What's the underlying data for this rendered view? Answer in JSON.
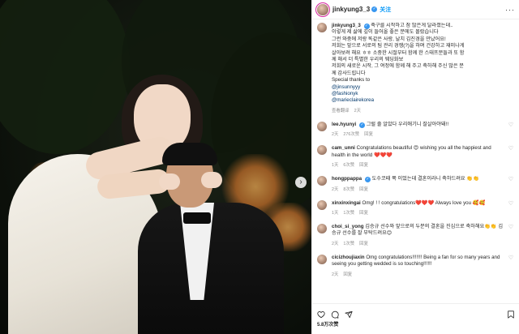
{
  "post": {
    "username": "jinkyung3_3",
    "follow_label": "关注",
    "more_label": "···",
    "caption": {
      "username": "jinkyung3_3",
      "lines": [
        "축구를 시작하고 참 많은게 달라졌는데..",
        "이렇게 제 삶에 깊이 들어올 좋은 분에도 몰랐습니다",
        "그런 와중에 저랑 똑같은 사랑, 날치 김진경을 만났어요!",
        "저희는 앞으로 서로의 팀 관리 경쟁(?)을 하며 건강하고 재미나게",
        "살아보려 해요 ㅎㅎ 소중한 시절부터 함께 한 스태프분들과 또 함",
        "께 해서 더 특별한 우리의 웨딩화보",
        "저희의 새로운 시작, 그 여정에 함께 해 주고 축하해 주신 많은 분",
        "께 감사드립니다"
      ],
      "special_thanks": "Special thanks to",
      "mentions": [
        "@jinsunnyyy",
        "@fashionyk",
        "@marieclairekorea"
      ],
      "translate_label": "查看翻译",
      "time_label": "2天"
    },
    "comments": [
      {
        "username": "lee.hyunyi",
        "verified": true,
        "text": "그럴 줄 알았다 우리애기니 잘살아야돼!!",
        "time": "2天",
        "likes": "276次赞",
        "reply": "回复"
      },
      {
        "username": "cam_unni",
        "verified": false,
        "text": "Congratulations beautiful 😍 wishing you all the happiest and health in the world ❤️❤️❤️",
        "time": "1天",
        "likes": "6次赞",
        "reply": "回复"
      },
      {
        "username": "hongppappa",
        "verified": true,
        "text": "도수코때 쭉 이었는데 결혼이라니 축하드려요 👏👏",
        "time": "2天",
        "likes": "8次赞",
        "reply": "回复"
      },
      {
        "username": "xinxinxingai",
        "verified": false,
        "text": "Omg! ! ! congratulations❤️❤️❤️ Always love you 🥰🥰",
        "time": "1天",
        "likes": "1次赞",
        "reply": "回复"
      },
      {
        "username": "choi_si_yong",
        "verified": false,
        "text": "김승규 선수와 앞으로의 두분의 결혼을 진심으로 축하해요👏👏 김승규 선수를 잘 부탁드려요😊",
        "time": "2天",
        "likes": "1次赞",
        "reply": "回复"
      },
      {
        "username": "cicizhoujiaxin",
        "verified": false,
        "text": "Omg congratulations!!!!!!! Being a fan for so many years and seeing you getting wedded is so touching!!!!!!",
        "time": "2天",
        "likes": "",
        "reply": "回复"
      }
    ],
    "likes_count": "5.8万次赞",
    "icons": [
      "heart-icon",
      "comment-icon",
      "share-icon",
      "bookmark-icon"
    ],
    "colors": {
      "accent": "#0095f6",
      "verified": "#3897f0",
      "text": "#262626",
      "meta": "#8e8e8e"
    }
  },
  "photo": {
    "carousel_next_label": "›"
  }
}
